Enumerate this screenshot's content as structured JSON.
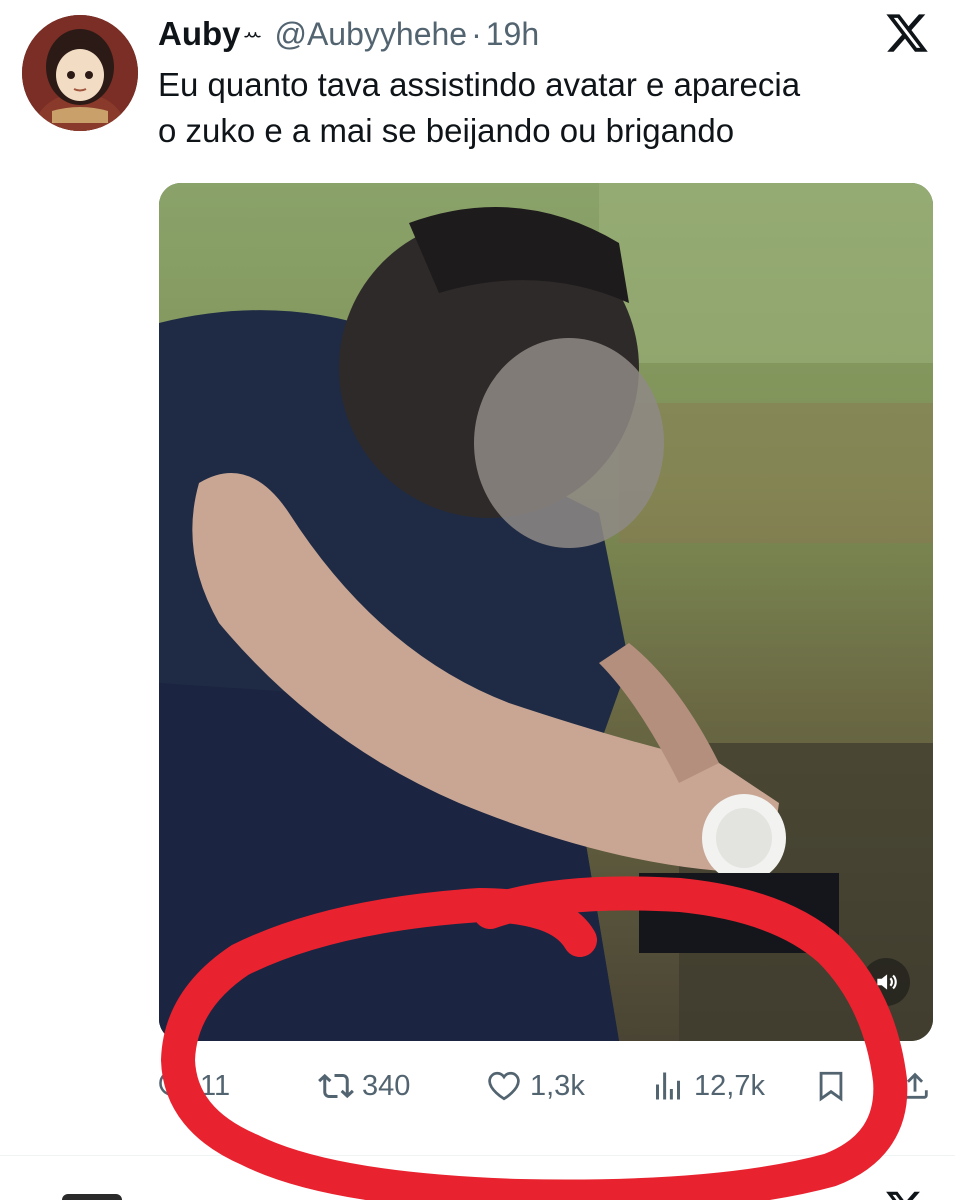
{
  "tweet": {
    "author": {
      "display_name": "Auby",
      "name_emoji": "ꕀ",
      "handle": "@Aubyyhehe",
      "avatar_icon": "avatar-cartoon-girl"
    },
    "separator": "·",
    "time": "19h",
    "text_lines": [
      "Eu quanto tava assistindo avatar e aparecia",
      "o zuko e a mai se beijando ou brigando"
    ],
    "media": {
      "type": "video",
      "sound_icon": "speaker-icon"
    },
    "actions": {
      "reply": {
        "icon": "reply-icon",
        "count": "11"
      },
      "retweet": {
        "icon": "retweet-icon",
        "count": "340"
      },
      "like": {
        "icon": "heart-icon",
        "count": "1,3k"
      },
      "views": {
        "icon": "views-icon",
        "count": "12,7k"
      },
      "bookmark": {
        "icon": "bookmark-icon"
      },
      "share": {
        "icon": "share-icon"
      }
    }
  },
  "platform_logo": "x-logo",
  "colors": {
    "text_primary": "#0f1419",
    "text_secondary": "#536471",
    "annotation_red": "#e8232f"
  }
}
